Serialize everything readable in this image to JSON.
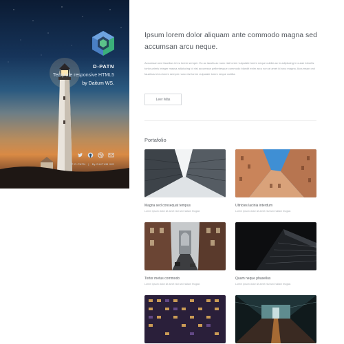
{
  "brand": {
    "name": "D-PATN",
    "subtitle_lead": "Template responsive HTML5",
    "subtitle_by": "by Daitum WS.",
    "footer_left": "© D-PATN",
    "footer_sep": "|",
    "footer_right": "By DAITUM WS"
  },
  "social_icons": [
    "twitter-icon",
    "github-icon",
    "dribbble-icon",
    "mail-icon"
  ],
  "main": {
    "headline": "Ipsum lorem dolor aliquam ante commodo magna sed accumsan arcu neque.",
    "intro": "Accumsan orci faucibus id eu lorem semper. Eu ac iaculis ac nunc nisi lorem vulputate lorem neque cubilia ac in adipiscing in curae lobortis tortor primis integer massa adipiscing id nisi accumsan pellentesque commodo blandit enim arcu non at amet id arcu magna. Accumsan orci faucibus id eu lorem semper nunc nisi lorem vulputate lorem neque cubilia.",
    "button": "Leer Más",
    "portfolio_title": "Portafolio"
  },
  "portfolio": [
    {
      "title": "Magna sed consequat tempus",
      "text": "Lorem ipsum dolor sit amet nisl sed nullam feugiat."
    },
    {
      "title": "Ultricies lacinia interdum",
      "text": "Lorem ipsum dolor sit amet nisl sed nullam feugiat."
    },
    {
      "title": "Tortor metus commodo",
      "text": "Lorem ipsum dolor sit amet nisl sed nullam feugiat."
    },
    {
      "title": "Quam neque phasellus",
      "text": "Lorem ipsum dolor sit amet nisl sed nullam feugiat."
    },
    {
      "title": "",
      "text": ""
    },
    {
      "title": "",
      "text": ""
    }
  ],
  "colors": {
    "headline": "#555a60",
    "body_text": "#9aa0a6",
    "logo_green": "#5cc28a",
    "logo_blue": "#5a8fd0"
  }
}
